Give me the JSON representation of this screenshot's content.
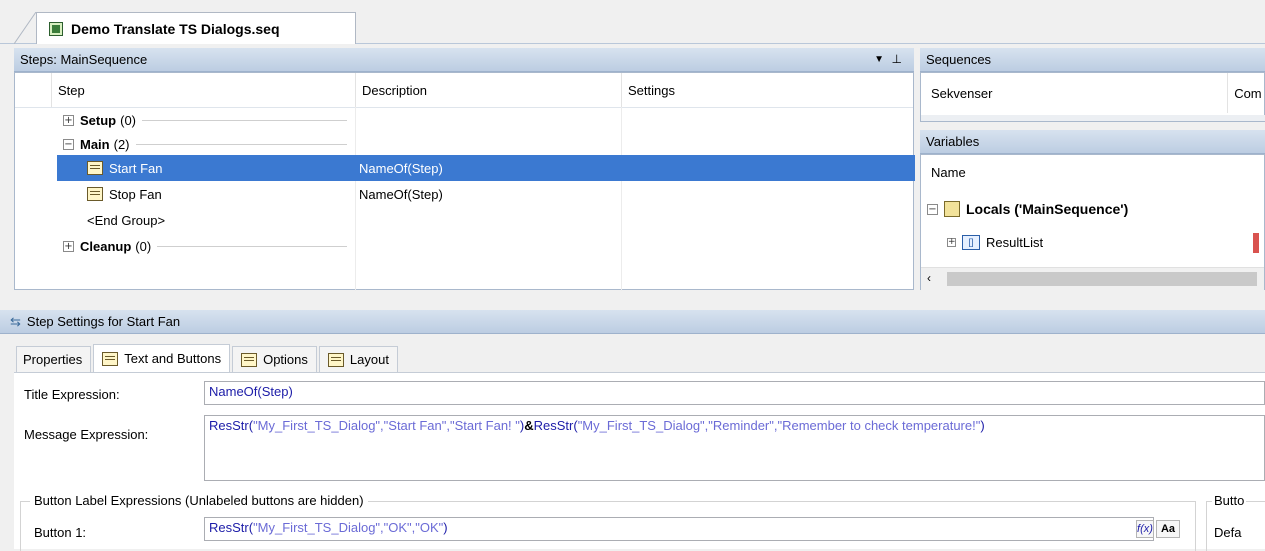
{
  "document_tab": {
    "title": "Demo Translate TS Dialogs.seq",
    "icon": "sequence-file-icon"
  },
  "steps_panel": {
    "header": "Steps: MainSequence",
    "columns": [
      "Step",
      "Description",
      "Settings"
    ],
    "rows": [
      {
        "type": "group",
        "label": "Setup",
        "count": "(0)",
        "expanded": false
      },
      {
        "type": "group",
        "label": "Main",
        "count": "(2)",
        "expanded": true
      },
      {
        "type": "step",
        "label": "Start Fan",
        "description": "NameOf(Step)",
        "selected": true
      },
      {
        "type": "step",
        "label": "Stop Fan",
        "description": "NameOf(Step)",
        "selected": false
      },
      {
        "type": "end",
        "label": "<End Group>"
      },
      {
        "type": "group",
        "label": "Cleanup",
        "count": "(0)",
        "expanded": false
      }
    ]
  },
  "sequences_panel": {
    "header": "Sequences",
    "columns": [
      "Sekvenser",
      "Com"
    ]
  },
  "variables_panel": {
    "header": "Variables",
    "column": "Name",
    "locals": "Locals ('MainSequence')",
    "result_list": "ResultList"
  },
  "step_settings": {
    "header": "Step Settings for Start Fan",
    "tabs": [
      "Properties",
      "Text and Buttons",
      "Options",
      "Layout"
    ],
    "active_tab": "Text and Buttons",
    "title_label": "Title Expression:",
    "title_value": "NameOf(Step)",
    "message_label": "Message Expression:",
    "message_parts": {
      "fn1": "ResStr(",
      "arg1": "\"My_First_TS_Dialog\",\"Start Fan\",\"Start Fan! \"",
      "close1": ")",
      "op": "&",
      "fn2": "ResStr(",
      "arg2": "\"My_First_TS_Dialog\",\"Reminder\",\"Remember to check temperature!\"",
      "close2": ")"
    },
    "button_group_label": "Button Label Expressions (Unlabeled buttons are hidden)",
    "button1_label": "Button 1:",
    "button1_parts": {
      "fn": "ResStr(",
      "arg": "\"My_First_TS_Dialog\",\"OK\",\"OK\"",
      "close": ")"
    },
    "fx_label": "f(x)",
    "aa_label": "Aa",
    "right_group_label": "Butto",
    "right_field_label": "Defa"
  },
  "colors": {
    "selection": "#3b79d1",
    "header_gradient_top": "#d7e2ef",
    "expression_function": "#1c1ca8",
    "expression_string": "#6b6bd6"
  }
}
